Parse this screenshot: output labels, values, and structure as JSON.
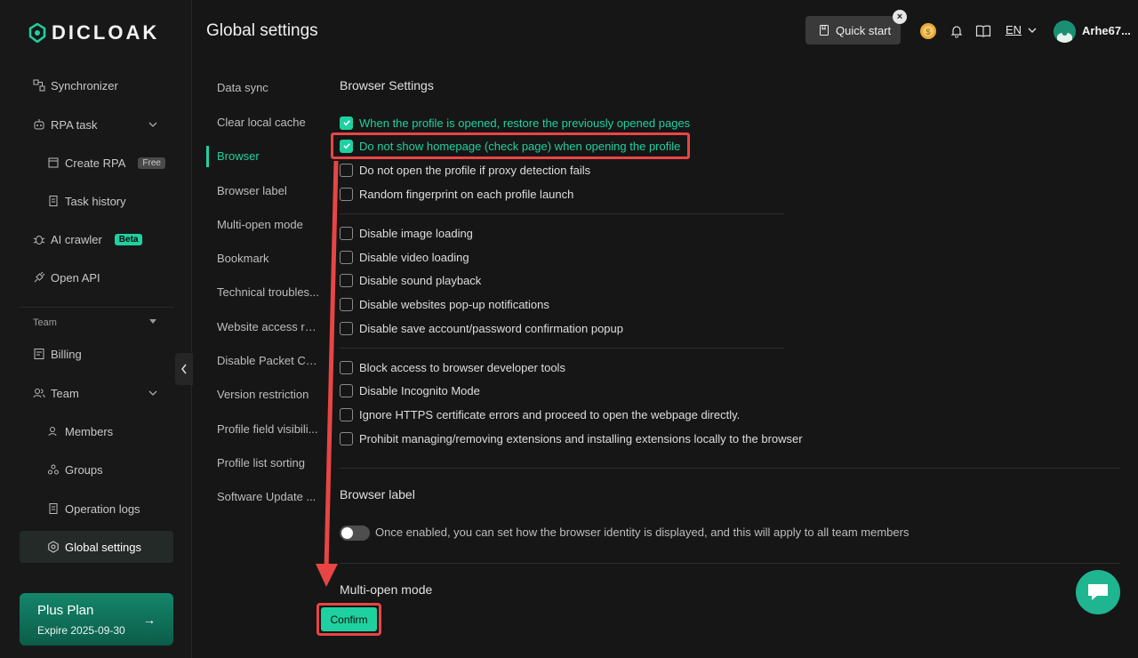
{
  "brand": {
    "name": "DICLOAK"
  },
  "header": {
    "title": "Global settings",
    "quick_start": "Quick start",
    "lang": "EN",
    "username": "Arhe67..."
  },
  "sidebar": {
    "items": [
      {
        "label": "Synchronizer"
      },
      {
        "label": "RPA task"
      },
      {
        "label": "Create RPA",
        "badge": "Free"
      },
      {
        "label": "Task history"
      },
      {
        "label": "AI crawler",
        "badge": "Beta"
      },
      {
        "label": "Open API"
      },
      {
        "label": "Billing"
      },
      {
        "label": "Team"
      },
      {
        "label": "Members"
      },
      {
        "label": "Groups"
      },
      {
        "label": "Operation logs"
      },
      {
        "label": "Global settings"
      }
    ],
    "section_team": "Team",
    "plan": {
      "title": "Plus Plan",
      "expire": "Expire 2025-09-30",
      "arrow": "→"
    }
  },
  "subnav": [
    "Data sync",
    "Clear local cache",
    "Browser",
    "Browser label",
    "Multi-open mode",
    "Bookmark",
    "Technical troubles...",
    "Website access re...",
    "Disable Packet Ca...",
    "Version restriction",
    "Profile field visibili...",
    "Profile list sorting",
    "Software Update ..."
  ],
  "browser_settings": {
    "title": "Browser Settings",
    "group1": [
      {
        "label": "When the profile is opened, restore the previously opened pages",
        "checked": true
      },
      {
        "label": "Do not show homepage (check page) when opening the profile",
        "checked": true
      },
      {
        "label": "Do not open the profile if proxy detection fails",
        "checked": false
      },
      {
        "label": "Random fingerprint on each profile launch",
        "checked": false
      }
    ],
    "group2": [
      {
        "label": "Disable image loading",
        "checked": false
      },
      {
        "label": "Disable video loading",
        "checked": false
      },
      {
        "label": "Disable sound playback",
        "checked": false
      },
      {
        "label": "Disable websites pop-up notifications",
        "checked": false
      },
      {
        "label": "Disable save account/password confirmation popup",
        "checked": false
      }
    ],
    "group3": [
      {
        "label": "Block access to browser developer tools",
        "checked": false
      },
      {
        "label": "Disable Incognito Mode",
        "checked": false
      },
      {
        "label": "Ignore HTTPS certificate errors and proceed to open the webpage directly.",
        "checked": false
      },
      {
        "label": "Prohibit managing/removing extensions and installing extensions locally to the browser",
        "checked": false
      }
    ]
  },
  "browser_label": {
    "title": "Browser label",
    "toggle_text": "Once enabled, you can set how the browser identity is displayed, and this will apply to all team members",
    "enabled": false
  },
  "multi_open": {
    "title": "Multi-open mode"
  },
  "confirm_label": "Confirm",
  "colors": {
    "accent": "#1fd1a0",
    "highlight": "#e84545",
    "background": "#161616"
  }
}
